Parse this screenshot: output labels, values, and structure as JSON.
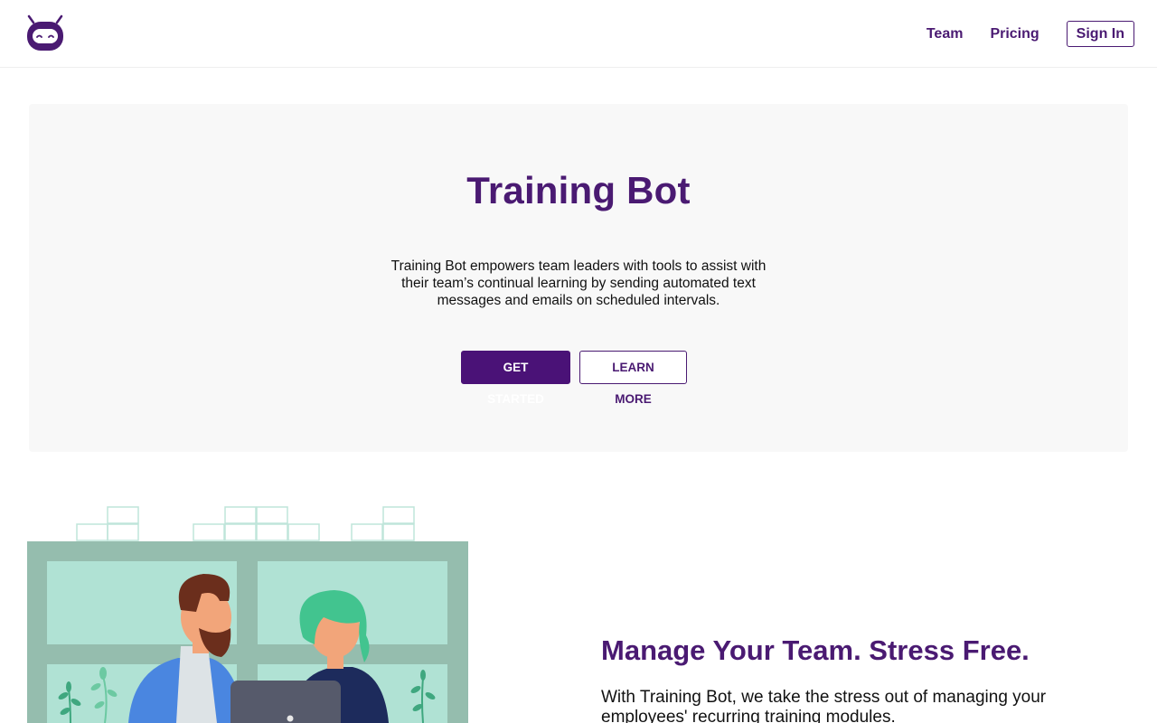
{
  "nav": {
    "logo_icon": "robot-face-icon",
    "links": [
      "Team",
      "Pricing"
    ],
    "signin_label": "Sign In"
  },
  "hero": {
    "title": "Training Bot",
    "description": "Training Bot empowers team leaders with tools to assist with their team’s continual learning by sending automated text messages and emails on scheduled intervals.",
    "primary_button": "GET STARTED",
    "secondary_button": "LEARN MORE"
  },
  "feature": {
    "title": "Manage Your Team. Stress Free.",
    "text": "With Training Bot, we take the stress out of managing your employees' recurring training modules."
  },
  "colors": {
    "brand": "#4a1a72",
    "hero_bg": "#f8f8f8",
    "window_frame": "#95bdae",
    "window_pane": "#b0e2d4"
  }
}
